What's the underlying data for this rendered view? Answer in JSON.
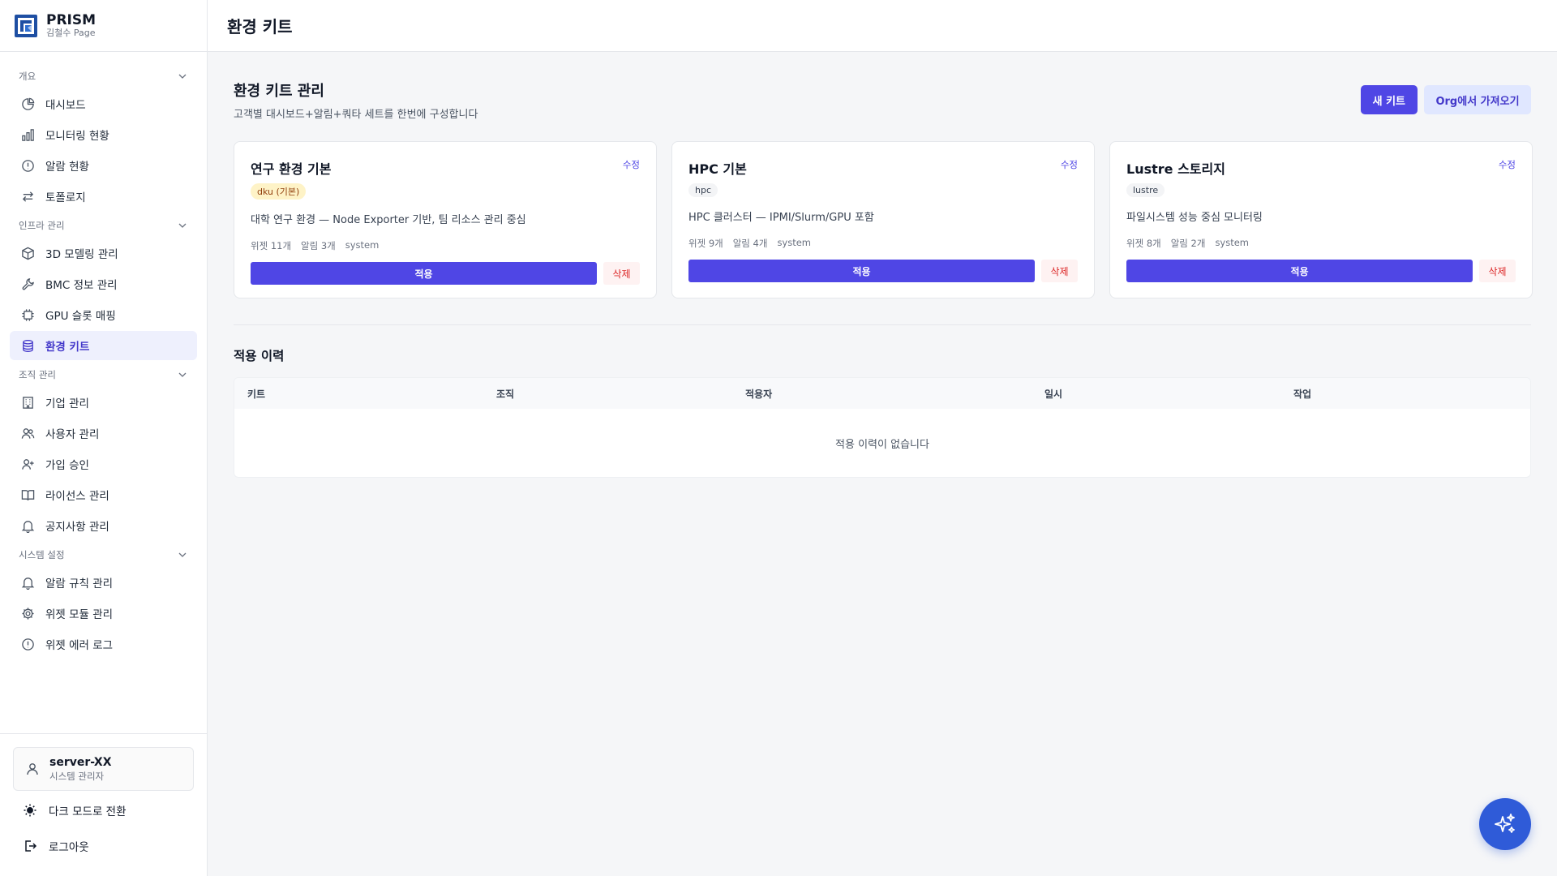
{
  "brand": {
    "title": "PRISM",
    "subtitle": "김철수 Page",
    "icon": "prism-logo-icon"
  },
  "topbar": {
    "title": "환경 키트"
  },
  "sidebar": {
    "sections": [
      {
        "label": "개요",
        "items": [
          {
            "label": "대시보드",
            "icon": "pie-chart-icon"
          },
          {
            "label": "모니터링 현황",
            "icon": "bar-chart-icon"
          },
          {
            "label": "알람 현황",
            "icon": "alert-circle-icon"
          },
          {
            "label": "토폴로지",
            "icon": "arrows-left-right-icon"
          }
        ]
      },
      {
        "label": "인프라 관리",
        "items": [
          {
            "label": "3D 모델링 관리",
            "icon": "cube-icon"
          },
          {
            "label": "BMC 정보 관리",
            "icon": "wrench-icon"
          },
          {
            "label": "GPU 슬롯 매핑",
            "icon": "chip-icon"
          },
          {
            "label": "환경 키트",
            "icon": "database-icon",
            "active": true
          }
        ]
      },
      {
        "label": "조직 관리",
        "items": [
          {
            "label": "기업 관리",
            "icon": "building-icon"
          },
          {
            "label": "사용자 관리",
            "icon": "users-icon"
          },
          {
            "label": "가입 승인",
            "icon": "user-plus-icon"
          },
          {
            "label": "라이선스 관리",
            "icon": "book-open-icon"
          },
          {
            "label": "공지사항 관리",
            "icon": "bell-icon"
          }
        ]
      },
      {
        "label": "시스템 설정",
        "items": [
          {
            "label": "알람 규칙 관리",
            "icon": "bell-icon"
          },
          {
            "label": "위젯 모듈 관리",
            "icon": "gear-icon"
          },
          {
            "label": "위젯 에러 로그",
            "icon": "alert-circle-icon"
          }
        ]
      }
    ],
    "footer": {
      "user_name": "server-XX",
      "user_role": "시스템 관리자",
      "dark_mode_label": "다크 모드로 전환",
      "logout_label": "로그아웃"
    }
  },
  "main": {
    "title": "환경 키트 관리",
    "subtitle": "고객별 대시보드+알림+쿼타 세트를 한번에 구성합니다",
    "new_kit_label": "새 키트",
    "import_label": "Org에서 가져오기",
    "cards": [
      {
        "title": "연구 환경 기본",
        "edit_label": "수정",
        "tag": "dku (기본)",
        "tag_style": "warn",
        "desc": "대학 연구 환경 — Node Exporter 기반, 팀 리소스 관리 중심",
        "widgets": "위젯 11개",
        "alarms": "알림 3개",
        "owner": "system",
        "apply_label": "적용",
        "delete_label": "삭제"
      },
      {
        "title": "HPC 기본",
        "edit_label": "수정",
        "tag": "hpc",
        "tag_style": "plain",
        "desc": "HPC 클러스터 — IPMI/Slurm/GPU 포함",
        "widgets": "위젯 9개",
        "alarms": "알림 4개",
        "owner": "system",
        "apply_label": "적용",
        "delete_label": "삭제"
      },
      {
        "title": "Lustre 스토리지",
        "edit_label": "수정",
        "tag": "lustre",
        "tag_style": "plain",
        "desc": "파일시스템 성능 중심 모니터링",
        "widgets": "위젯 8개",
        "alarms": "알림 2개",
        "owner": "system",
        "apply_label": "적용",
        "delete_label": "삭제"
      }
    ],
    "history": {
      "title": "적용 이력",
      "columns": [
        "키트",
        "조직",
        "적용자",
        "일시",
        "작업"
      ],
      "empty_text": "적용 이력이 없습니다"
    }
  },
  "fab": {
    "icon": "sparkles-icon"
  },
  "colors": {
    "accent": "#4f46e5",
    "danger": "#dc2626",
    "fab": "#2f5bd8"
  }
}
